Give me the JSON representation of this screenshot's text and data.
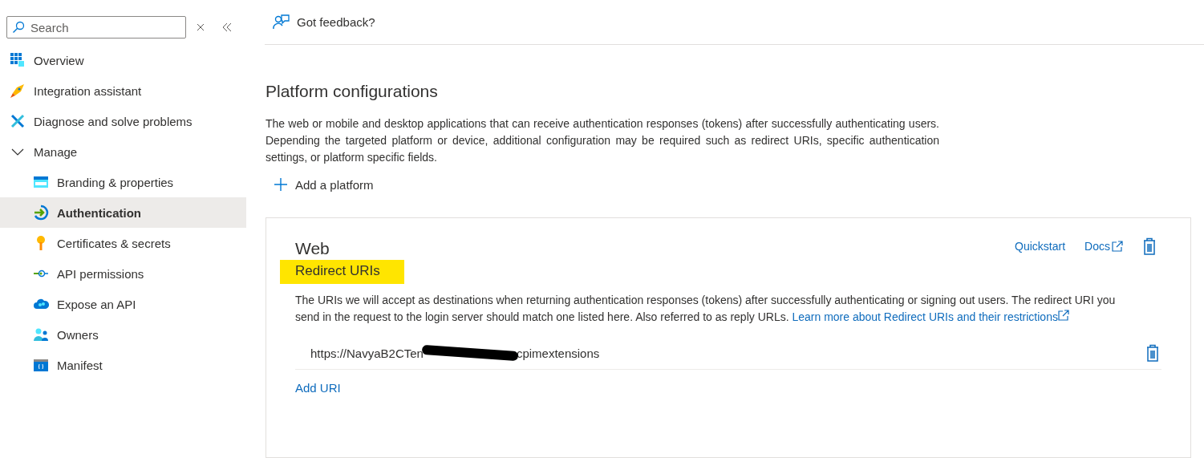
{
  "sidebar": {
    "search": {
      "placeholder": "Search"
    },
    "items": [
      {
        "label": "Overview",
        "selected": false
      },
      {
        "label": "Integration assistant",
        "selected": false
      },
      {
        "label": "Diagnose and solve problems",
        "selected": false
      },
      {
        "label": "Manage",
        "expanded": true,
        "children": [
          {
            "label": "Branding & properties",
            "selected": false
          },
          {
            "label": "Authentication",
            "selected": true
          },
          {
            "label": "Certificates & secrets",
            "selected": false
          },
          {
            "label": "API permissions",
            "selected": false
          },
          {
            "label": "Expose an API",
            "selected": false
          },
          {
            "label": "Owners",
            "selected": false
          },
          {
            "label": "Manifest",
            "selected": false
          }
        ]
      }
    ]
  },
  "toolbar": {
    "feedback": "Got feedback?"
  },
  "main": {
    "title": "Platform configurations",
    "description": "The web or mobile and desktop applications that can receive authentication responses (tokens) after successfully authenticating users. Depending the targeted platform or device, additional configuration may be required such as redirect URIs, specific authentication settings, or platform specific fields.",
    "add_platform": "Add a platform",
    "card": {
      "title": "Web",
      "quickstart": "Quickstart",
      "docs": "Docs",
      "section": "Redirect URIs",
      "highlighted": true,
      "text": "The URIs we will accept as destinations when returning authentication responses (tokens) after successfully authenticating or signing out users. The redirect URI you send in the request to the login server should match one listed here. Also referred to as reply URLs.",
      "link": "Learn more about Redirect URIs and their restrictions",
      "uris": [
        {
          "start": "https://NavyaB2CTen",
          "end": "cpimextensions",
          "redacted": true
        }
      ],
      "add_uri": "Add URI"
    }
  }
}
